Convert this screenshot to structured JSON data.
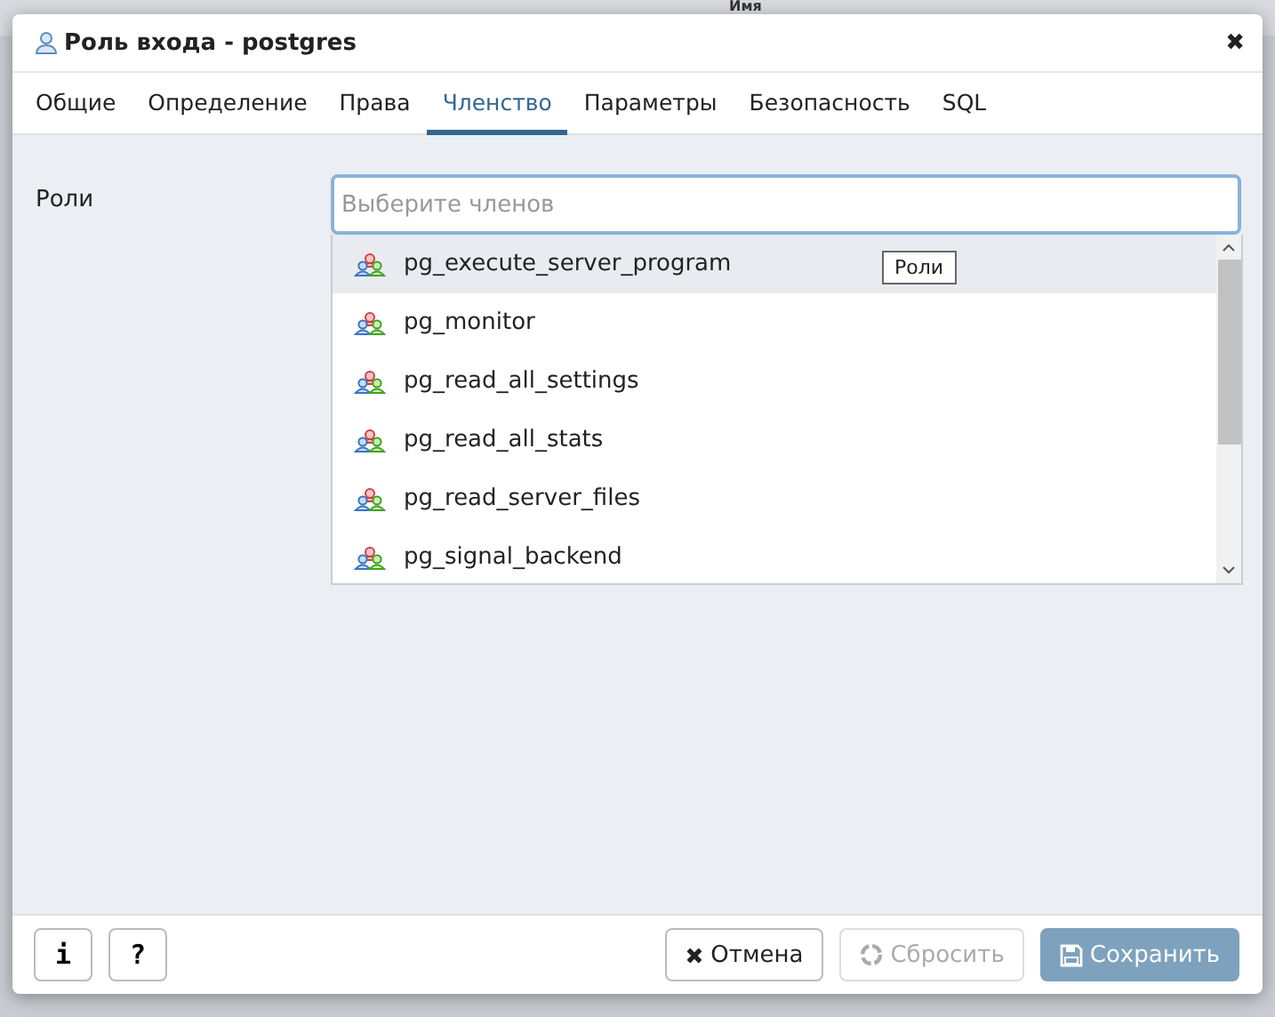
{
  "background": {
    "column_header": "Имя"
  },
  "window": {
    "title": "Роль входа - postgres",
    "close": "✖"
  },
  "tabs": [
    {
      "label": "Общие",
      "selected": false
    },
    {
      "label": "Определение",
      "selected": false
    },
    {
      "label": "Права",
      "selected": false
    },
    {
      "label": "Членство",
      "selected": true
    },
    {
      "label": "Параметры",
      "selected": false
    },
    {
      "label": "Безопасность",
      "selected": false
    },
    {
      "label": "SQL",
      "selected": false
    }
  ],
  "field": {
    "label": "Роли",
    "placeholder": "Выберите членов"
  },
  "options": [
    {
      "label": "pg_execute_server_program",
      "highlighted": true
    },
    {
      "label": "pg_monitor",
      "highlighted": false
    },
    {
      "label": "pg_read_all_settings",
      "highlighted": false
    },
    {
      "label": "pg_read_all_stats",
      "highlighted": false
    },
    {
      "label": "pg_read_server_files",
      "highlighted": false
    },
    {
      "label": "pg_signal_backend",
      "highlighted": false
    }
  ],
  "tooltip": "Роли",
  "footer": {
    "left_buttons": [
      "i",
      "?"
    ],
    "buttons": [
      {
        "kind": "cancel",
        "label": "Отмена",
        "disabled": false
      },
      {
        "kind": "reset",
        "label": "Сбросить",
        "disabled": true
      },
      {
        "kind": "save",
        "label": "Сохранить",
        "disabled": true
      }
    ]
  }
}
